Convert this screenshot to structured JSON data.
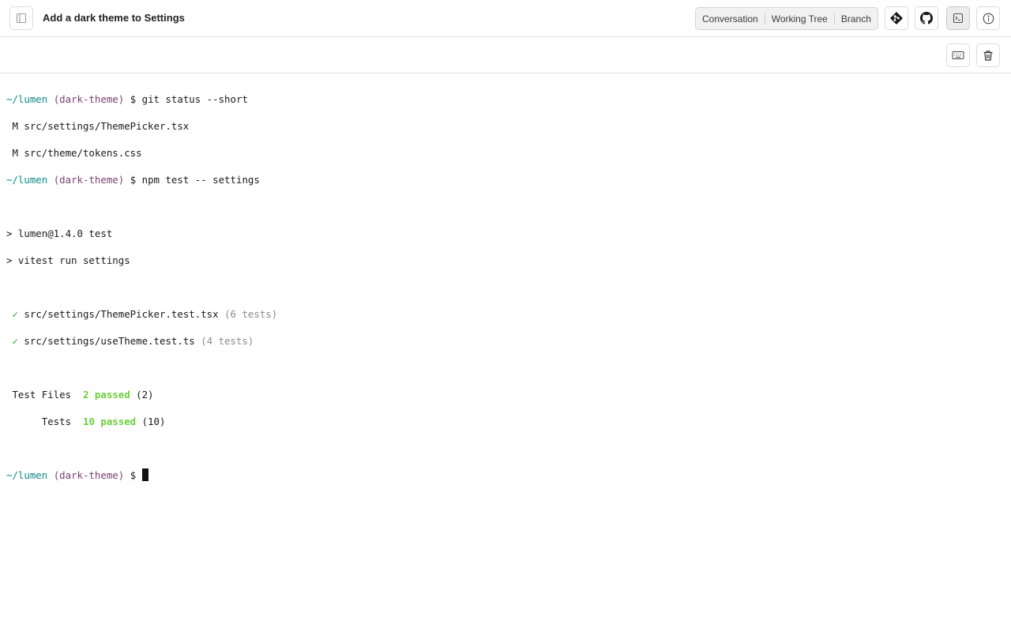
{
  "header": {
    "title": "Add a dark theme to Settings",
    "tabs": [
      {
        "label": "Conversation"
      },
      {
        "label": "Working Tree"
      },
      {
        "label": "Branch"
      }
    ]
  },
  "icons": {
    "sidebar_toggle": "sidebar-toggle-icon",
    "git": "git-icon",
    "github": "github-icon",
    "terminal": "terminal-icon",
    "info": "info-icon",
    "keyboard": "keyboard-icon",
    "trash": "trash-icon"
  },
  "colors": {
    "prompt_path": "#0b8a8a",
    "prompt_branch": "#7a3e73",
    "check": "#2f9e23",
    "passed": "#6ad13b",
    "dim": "#8a8a8a"
  },
  "terminal": {
    "prompt": {
      "path": "~/lumen",
      "branch": "(dark-theme)",
      "symbol": "$"
    },
    "cmd1": "git status --short",
    "status_lines": [
      " M src/settings/ThemePicker.tsx",
      " M src/theme/tokens.css"
    ],
    "cmd2": "npm test -- settings",
    "script_lines": [
      "> lumen@1.4.0 test",
      "> vitest run settings"
    ],
    "check_mark": "✓",
    "test_results": [
      {
        "file": "src/settings/ThemePicker.test.tsx",
        "count": "(6 tests)"
      },
      {
        "file": "src/settings/useTheme.test.ts",
        "count": "(4 tests)"
      }
    ],
    "summary": [
      {
        "label": " Test Files",
        "passed": "2 passed",
        "total": "(2)"
      },
      {
        "label": "      Tests",
        "passed": "10 passed",
        "total": "(10)"
      }
    ]
  }
}
